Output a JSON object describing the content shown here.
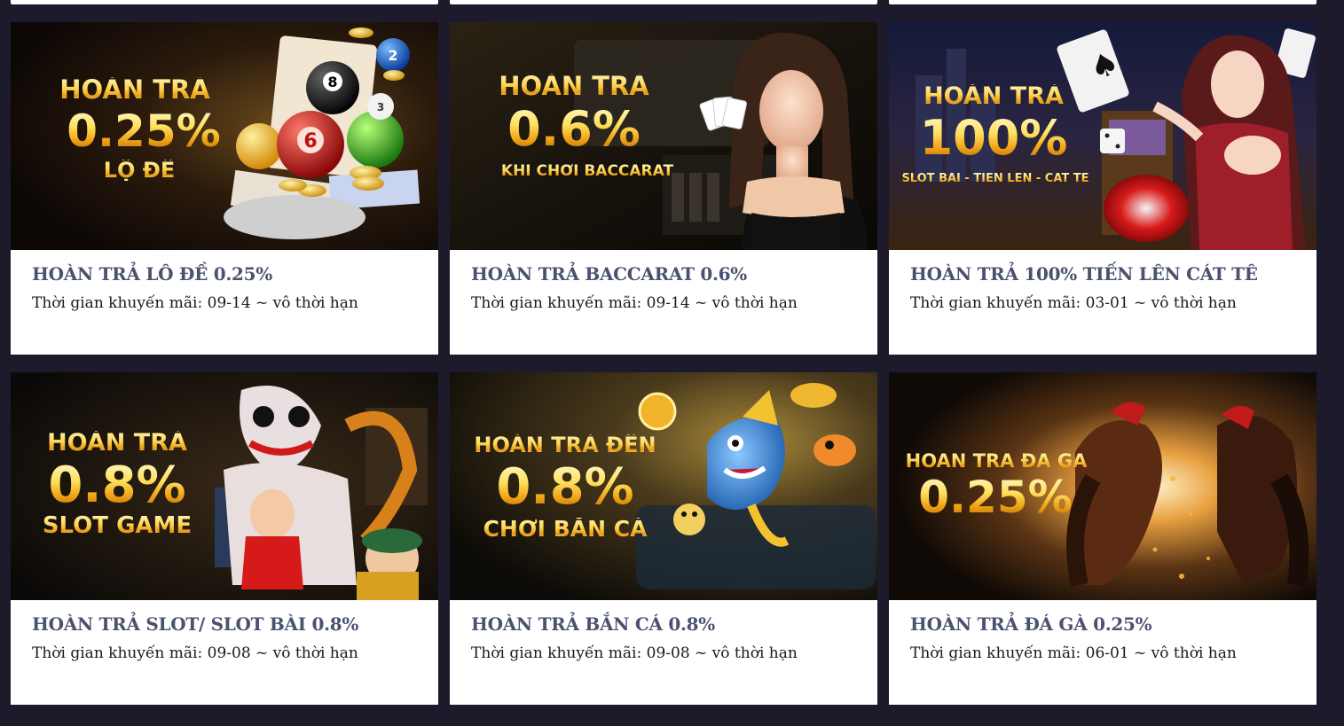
{
  "promos": [
    {
      "banner": {
        "line1": "HOÀN TRẢ",
        "big": "0.25%",
        "line2": "LỘ ĐỀ",
        "theme": "lottery",
        "balls": [
          "8",
          "6",
          "2",
          "3"
        ]
      },
      "title": "HOÀN TRẢ LÔ ĐỀ 0.25%",
      "time_label": "Thời gian khuyến mãi:",
      "time_value": "09-14 ~ vô thời hạn"
    },
    {
      "banner": {
        "line1": "HOÀN TRẢ",
        "big": "0.6%",
        "line2": "KHI CHƠI BACCARAT",
        "theme": "baccarat"
      },
      "title": "HOÀN TRẢ BACCARAT 0.6%",
      "time_label": "Thời gian khuyến mãi:",
      "time_value": "09-14 ~ vô thời hạn"
    },
    {
      "banner": {
        "line1": "HOÀN TRẢ",
        "big": "100%",
        "line2": "SLOT BÀI - TIẾN LÊN - CÁT TÊ",
        "theme": "cards"
      },
      "title": "HOÀN TRẢ 100% TIẾN LÊN CÁT TÊ",
      "time_label": "Thời gian khuyến mãi:",
      "time_value": "03-01 ~ vô thời hạn"
    },
    {
      "banner": {
        "line1": "HOÀN TRẢ",
        "big": "0.8%",
        "line2": "SLOT GAME",
        "theme": "slot"
      },
      "title": "HOÀN TRẢ SLOT/ SLOT BÀI 0.8%",
      "time_label": "Thời gian khuyến mãi:",
      "time_value": "09-08 ~ vô thời hạn"
    },
    {
      "banner": {
        "line1": "HOÀN TRẢ ĐẾN",
        "big": "0.8%",
        "line2": "CHƠI BẮN CÁ",
        "theme": "fish"
      },
      "title": "HOÀN TRẢ BẮN CÁ 0.8%",
      "time_label": "Thời gian khuyến mãi:",
      "time_value": "09-08 ~ vô thời hạn"
    },
    {
      "banner": {
        "line1": "HOÀN TRẢ ĐÁ GÀ",
        "big": "0.25%",
        "line2": "",
        "theme": "cockfight"
      },
      "title": "HOÀN TRẢ ĐÁ GÀ 0.25%",
      "time_label": "Thời gian khuyến mãi:",
      "time_value": "06-01 ~ vô thời hạn"
    }
  ],
  "colors": {
    "page_bg": "#1d1a2b",
    "title": "#4a5270",
    "gold": "#ffd451"
  }
}
